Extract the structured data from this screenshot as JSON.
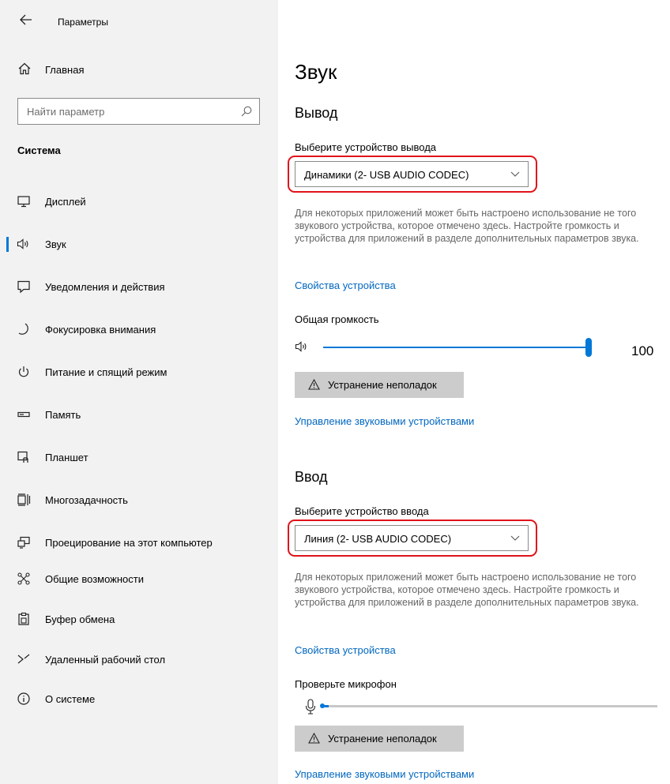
{
  "app": {
    "title": "Параметры"
  },
  "sidebar": {
    "home_label": "Главная",
    "search_placeholder": "Найти параметр",
    "section_title": "Система",
    "items": [
      {
        "label": "Дисплей",
        "icon": "monitor-icon"
      },
      {
        "label": "Звук",
        "icon": "speaker-icon",
        "selected": true
      },
      {
        "label": "Уведомления и действия",
        "icon": "notification-icon"
      },
      {
        "label": "Фокусировка внимания",
        "icon": "moon-icon"
      },
      {
        "label": "Питание и спящий режим",
        "icon": "power-icon"
      },
      {
        "label": "Память",
        "icon": "storage-icon"
      },
      {
        "label": "Планшет",
        "icon": "tablet-icon"
      },
      {
        "label": "Многозадачность",
        "icon": "multitasking-icon"
      },
      {
        "label": "Проецирование на этот компьютер",
        "icon": "projection-icon"
      },
      {
        "label": "Общие возможности",
        "icon": "shared-experiences-icon"
      },
      {
        "label": "Буфер обмена",
        "icon": "clipboard-icon"
      },
      {
        "label": "Удаленный рабочий стол",
        "icon": "remote-desktop-icon"
      },
      {
        "label": "О системе",
        "icon": "info-icon"
      }
    ]
  },
  "main": {
    "title": "Звук",
    "output": {
      "heading": "Вывод",
      "select_label": "Выберите устройство вывода",
      "device": "Динамики (2- USB AUDIO  CODEC)",
      "description": "Для некоторых приложений может быть настроено использование не того звукового устройства, которое отмечено здесь. Настройте громкость и устройства для приложений в разделе дополнительных параметров звука.",
      "properties_link": "Свойства устройства",
      "volume_label": "Общая громкость",
      "volume_value": "100",
      "volume_level": 1.0,
      "troubleshoot_label": "Устранение неполадок",
      "manage_link": "Управление звуковыми устройствами"
    },
    "input": {
      "heading": "Ввод",
      "select_label": "Выберите устройство ввода",
      "device": "Линия (2- USB AUDIO  CODEC)",
      "description": "Для некоторых приложений может быть настроено использование не того звукового устройства, которое отмечено здесь. Настройте громкость и устройства для приложений в разделе дополнительных параметров звука.",
      "properties_link": "Свойства устройства",
      "test_label": "Проверьте микрофон",
      "mic_level": 0.02,
      "troubleshoot_label": "Устранение неполадок",
      "manage_link": "Управление звуковыми устройствами"
    }
  },
  "colors": {
    "accent": "#0078d7",
    "link": "#0067c0",
    "highlight": "#e0131a",
    "sidebar_bg": "#f2f2f2"
  }
}
